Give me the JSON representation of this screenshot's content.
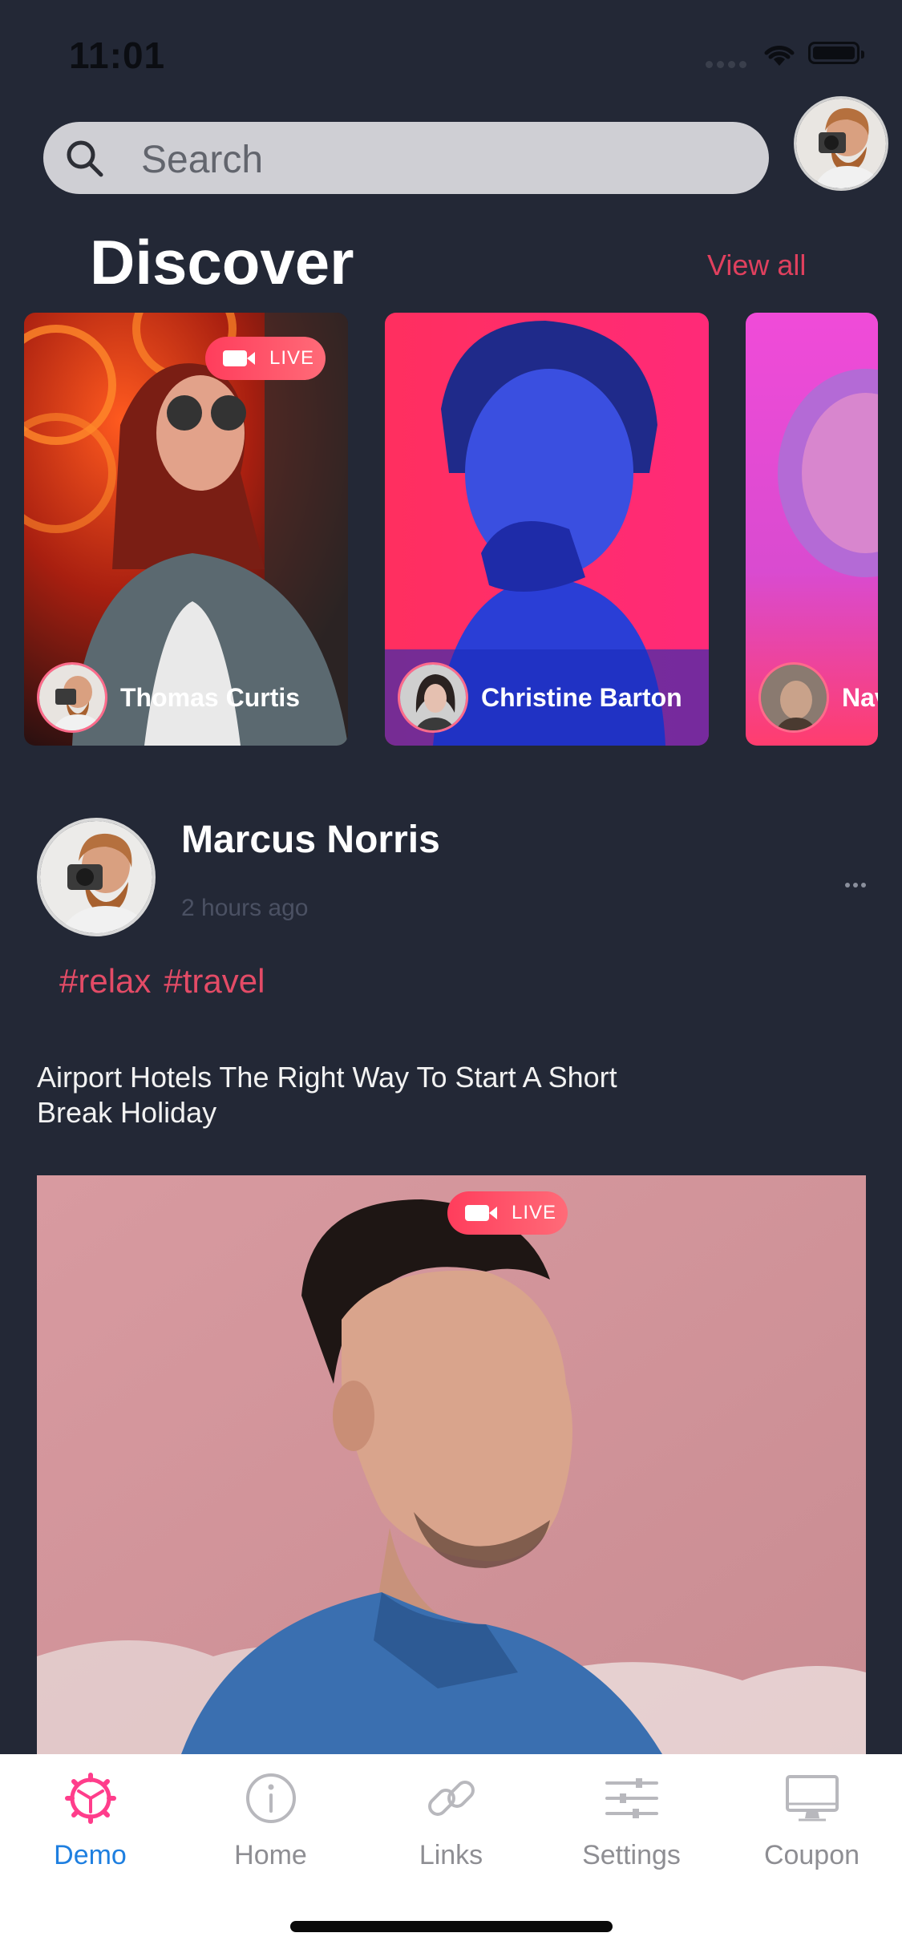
{
  "status_bar": {
    "time": "11:01"
  },
  "search": {
    "placeholder": "Search"
  },
  "discover": {
    "title": "Discover",
    "view_all": "View all",
    "live_label": "LIVE",
    "cards": [
      {
        "name": "Thomas Curtis",
        "live": true
      },
      {
        "name": "Christine Barton",
        "live": false
      },
      {
        "name": "Navy",
        "live": false
      }
    ]
  },
  "post": {
    "author": "Marcus Norris",
    "time": "2 hours ago",
    "tags": [
      "#relax",
      "#travel"
    ],
    "text": "Airport Hotels The Right Way To Start A Short Break Holiday",
    "live_label": "LIVE"
  },
  "tabbar": {
    "items": [
      {
        "label": "Demo",
        "icon": "gear-icon",
        "active": true
      },
      {
        "label": "Home",
        "icon": "info-icon",
        "active": false
      },
      {
        "label": "Links",
        "icon": "link-icon",
        "active": false
      },
      {
        "label": "Settings",
        "icon": "sliders-icon",
        "active": false
      },
      {
        "label": "Coupon",
        "icon": "monitor-icon",
        "active": false
      }
    ]
  },
  "colors": {
    "accent": "#e0405e",
    "background": "#232836",
    "tab_active": "#1e7fe0"
  }
}
